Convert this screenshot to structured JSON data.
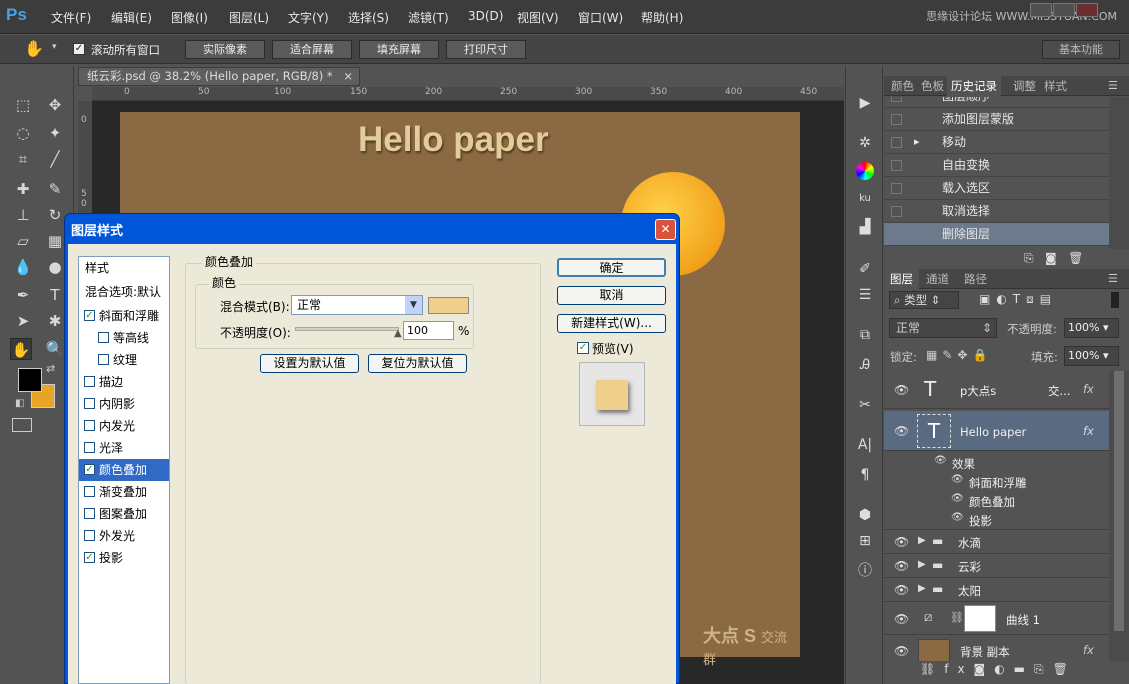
{
  "app": {
    "logo": "Ps",
    "watermark": "思缘设计论坛 WWW.MISSYUAN.COM"
  },
  "menu": [
    "文件(F)",
    "编辑(E)",
    "图像(I)",
    "图层(L)",
    "文字(Y)",
    "选择(S)",
    "滤镜(T)",
    "3D(D)",
    "视图(V)",
    "窗口(W)",
    "帮助(H)"
  ],
  "options": {
    "scroll_all": "滚动所有窗口",
    "actual_pixels": "实际像素",
    "fit_screen": "适合屏幕",
    "fill_screen": "填充屏幕",
    "print_size": "打印尺寸",
    "workspace": "基本功能"
  },
  "document": {
    "tab_title": "纸云彩.psd @ 38.2% (Hello paper, RGB/8) *",
    "close": "×",
    "canvas_text": "Hello paper",
    "logo_text": "大点 S",
    "logo_sub": "交流群"
  },
  "ruler": {
    "h": [
      "0",
      "50",
      "100",
      "150",
      "200",
      "250",
      "300",
      "350",
      "400",
      "450"
    ],
    "v": [
      "0",
      "5",
      "0"
    ]
  },
  "history_panel": {
    "tabs": [
      "颜色",
      "色板",
      "历史记录",
      "调整",
      "样式"
    ],
    "items": [
      "图层顺序",
      "添加图层蒙版",
      "移动",
      "自由变换",
      "载入选区",
      "取消选择",
      "删除图层"
    ]
  },
  "layers_panel": {
    "tabs": [
      "图层",
      "通道",
      "路径"
    ],
    "filter_label": "类型",
    "blend_mode": "正常",
    "opacity_label": "不透明度:",
    "opacity_value": "100%",
    "lock_label": "锁定:",
    "fill_label": "填充:",
    "fill_value": "100%",
    "layers": [
      {
        "name": "p大点s",
        "extra": "交...",
        "fx": "fx"
      },
      {
        "name": "Hello paper",
        "fx": "fx"
      },
      {
        "name": "效果"
      },
      {
        "name": "斜面和浮雕"
      },
      {
        "name": "颜色叠加"
      },
      {
        "name": "投影"
      },
      {
        "name": "水滴"
      },
      {
        "name": "云彩"
      },
      {
        "name": "太阳"
      },
      {
        "name": "曲线 1"
      },
      {
        "name": "背景 副本",
        "fx": "fx"
      }
    ]
  },
  "dialog": {
    "title": "图层样式",
    "close": "✕",
    "styles_header": "样式",
    "blend_options": "混合选项:默认",
    "styles": [
      {
        "label": "斜面和浮雕",
        "checked": true
      },
      {
        "label": "等高线",
        "checked": false
      },
      {
        "label": "纹理",
        "checked": false
      },
      {
        "label": "描边",
        "checked": false
      },
      {
        "label": "内阴影",
        "checked": false
      },
      {
        "label": "内发光",
        "checked": false
      },
      {
        "label": "光泽",
        "checked": false
      },
      {
        "label": "颜色叠加",
        "checked": true
      },
      {
        "label": "渐变叠加",
        "checked": false
      },
      {
        "label": "图案叠加",
        "checked": false
      },
      {
        "label": "外发光",
        "checked": false
      },
      {
        "label": "投影",
        "checked": true
      }
    ],
    "section_title": "颜色叠加",
    "subsection_title": "颜色",
    "blend_mode_label": "混合模式(B):",
    "blend_mode_value": "正常",
    "overlay_color": "#f0cf8c",
    "opacity_label": "不透明度(O):",
    "opacity_value": "100",
    "percent": "%",
    "set_default": "设置为默认值",
    "reset_default": "复位为默认值",
    "ok": "确定",
    "cancel": "取消",
    "new_style": "新建样式(W)...",
    "preview_label": "预览(V)"
  }
}
